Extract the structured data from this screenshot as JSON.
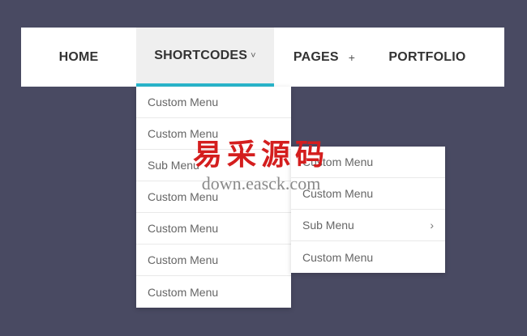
{
  "colors": {
    "background": "#494a62",
    "accent": "#29b6cc",
    "navbar": "#ffffff"
  },
  "nav": {
    "home": "HOME",
    "shortcodes": "SHORTCODES",
    "shortcodes_caret": "˅",
    "pages": "PAGES",
    "pages_plus": "+",
    "portfolio": "PORTFOLIO"
  },
  "dropdown": {
    "items": [
      "Custom Menu",
      "Custom Menu",
      "Sub Menu",
      "Custom Menu",
      "Custom Menu",
      "Custom Menu",
      "Custom Menu"
    ]
  },
  "submenu": {
    "items": [
      "Custom Menu",
      "Custom Menu",
      "Sub Menu",
      "Custom Menu"
    ],
    "chevron_icon": "chevron-right-icon",
    "chevron": "›"
  },
  "watermark": {
    "line1": "易采源码",
    "line2": "down.easck.com"
  }
}
